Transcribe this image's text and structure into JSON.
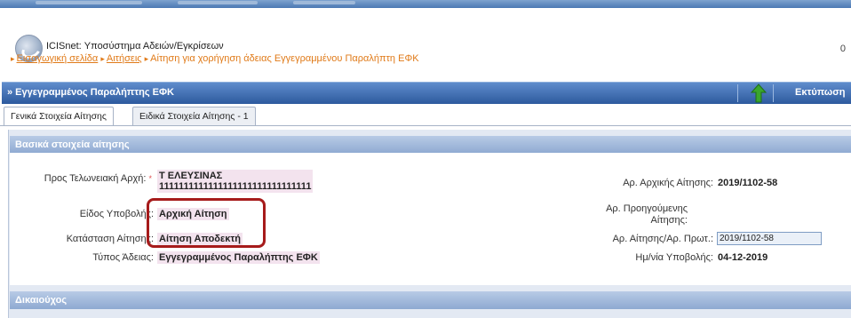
{
  "header": {
    "app_title": "ICISnet: Υποσύστημα Αδειών/Εγκρίσεων",
    "right_number": "0",
    "breadcrumbs": [
      {
        "label": "Εισαγωγική σελίδα",
        "link": true
      },
      {
        "label": "Αιτήσεις",
        "link": true
      },
      {
        "label": "Αίτηση για χορήγηση άδειας Εγγεγραμμένου Παραλήπτη ΕΦΚ",
        "link": false
      }
    ]
  },
  "toolbar": {
    "title": "» Εγγεγραμμένος Παραλήπτης ΕΦΚ",
    "up_icon": "up-arrow-icon",
    "print_label": "Εκτύπωση"
  },
  "tabs": [
    {
      "label": "Γενικά Στοιχεία Αίτησης",
      "active": true
    },
    {
      "label": "Ειδικά Στοιχεία Αίτησης - 1",
      "active": false
    }
  ],
  "sections": {
    "basic_title": "Βασικά στοιχεία αίτησης",
    "holder_title": "Δικαιούχος"
  },
  "fields": {
    "customs_office_label": "Προς Τελωνειακή Αρχή:",
    "customs_office_required": "*",
    "customs_office_value_1": "Τ ΕΛΕΥΣΙΝΑΣ",
    "customs_office_value_2": "1111111111111111111111111111111",
    "submission_type_label": "Είδος Υποβολής:",
    "submission_type_value": "Αρχική Αίτηση",
    "status_label": "Κατάσταση Αίτησης:",
    "status_value": "Αίτηση Αποδεκτή",
    "license_type_label": "Τύπος Άδειας:",
    "license_type_value": "Εγγεγραμμένος Παραλήπτης ΕΦΚ",
    "initial_app_label": "Αρ. Αρχικής Αίτησης:",
    "initial_app_value": "2019/1102-58",
    "previous_app_label_1": "Αρ. Προηγούμενης",
    "previous_app_label_2": "Αίτησης:",
    "app_protocol_label": "Αρ. Αίτησης/Αρ. Πρωτ.:",
    "app_protocol_value": "2019/1102-58",
    "submission_date_label": "Ημ/νία Υποβολής:",
    "submission_date_value": "04-12-2019"
  },
  "colors": {
    "toolbar_blue": "#2d5a9e",
    "link_orange": "#e07a18",
    "highlight_box": "#a61b1b",
    "up_arrow_green": "#3aa62c"
  }
}
